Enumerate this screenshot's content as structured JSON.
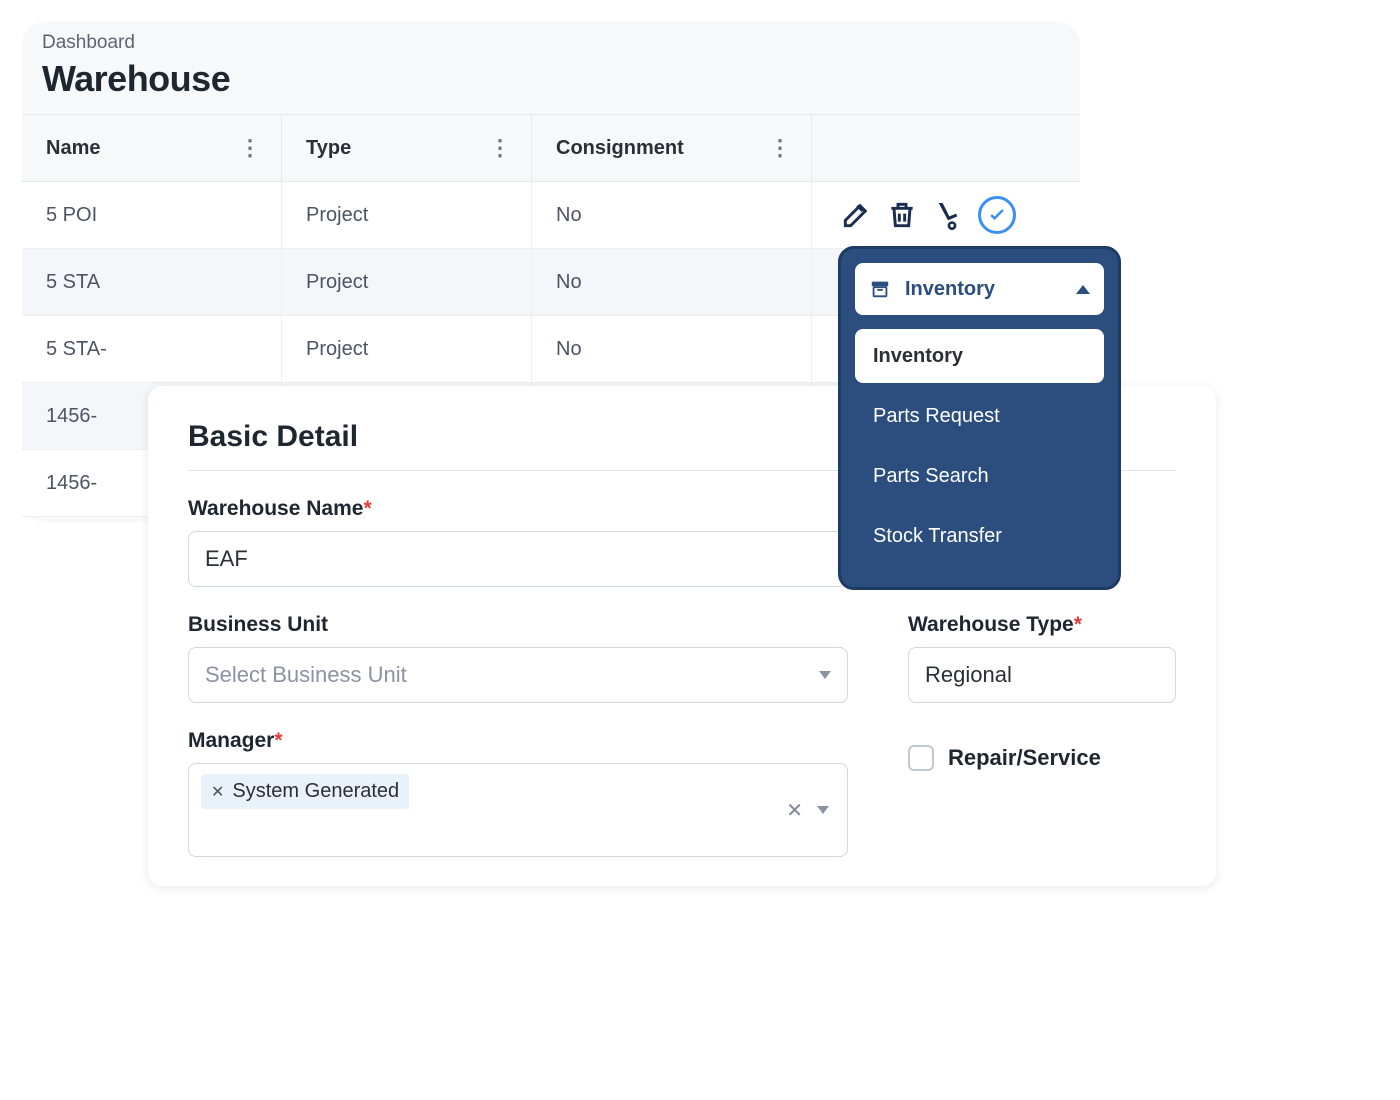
{
  "breadcrumb": "Dashboard",
  "page_title": "Warehouse",
  "columns": {
    "name": "Name",
    "type": "Type",
    "consignment": "Consignment"
  },
  "rows": [
    {
      "name": "5 POI",
      "type": "Project",
      "consignment": "No"
    },
    {
      "name": "5 STA",
      "type": "Project",
      "consignment": "No"
    },
    {
      "name": "5 STA-",
      "type": "Project",
      "consignment": "No"
    },
    {
      "name": "1456-",
      "type": "",
      "consignment": ""
    },
    {
      "name": "1456-",
      "type": "",
      "consignment": ""
    }
  ],
  "inventory_menu": {
    "selected": "Inventory",
    "items": [
      "Inventory",
      "Parts Request",
      "Parts Search",
      "Stock Transfer"
    ]
  },
  "form": {
    "title": "Basic Detail",
    "warehouse_name": {
      "label": "Warehouse Name",
      "value": "EAF"
    },
    "business_unit": {
      "label": "Business Unit",
      "placeholder": "Select Business Unit"
    },
    "warehouse_type": {
      "label": "Warehouse Type",
      "value": "Regional"
    },
    "manager": {
      "label": "Manager",
      "tag": "System Generated"
    },
    "repair_service": {
      "label": "Repair/Service",
      "checked": false
    }
  }
}
